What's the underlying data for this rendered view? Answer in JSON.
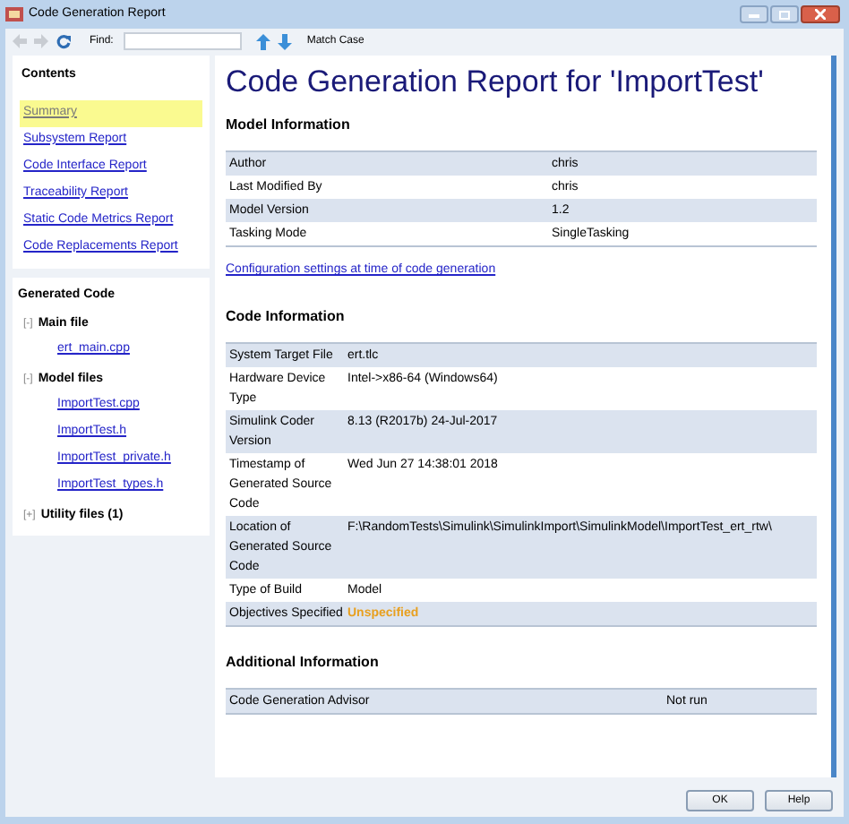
{
  "window": {
    "title": "Code Generation Report"
  },
  "toolbar": {
    "find_label": "Find:",
    "match_case": "Match Case"
  },
  "sidebar": {
    "contents": {
      "heading": "Contents",
      "items": [
        {
          "label": "Summary",
          "selected": true
        },
        {
          "label": "Subsystem Report",
          "selected": false
        },
        {
          "label": "Code Interface Report",
          "selected": false
        },
        {
          "label": "Traceability Report",
          "selected": false
        },
        {
          "label": "Static Code Metrics Report",
          "selected": false
        },
        {
          "label": "Code Replacements Report",
          "selected": false
        }
      ]
    },
    "generated_code": {
      "heading": "Generated Code",
      "groups": [
        {
          "toggle": "[-]",
          "label": "Main file",
          "files": [
            "ert_main.cpp"
          ]
        },
        {
          "toggle": "[-]",
          "label": "Model files",
          "files": [
            "ImportTest.cpp",
            "ImportTest.h",
            "ImportTest_private.h",
            "ImportTest_types.h"
          ]
        },
        {
          "toggle": "[+]",
          "label": "Utility files (1)"
        }
      ]
    }
  },
  "main": {
    "title": "Code Generation Report for 'ImportTest'",
    "sections": [
      {
        "heading": "Model Information",
        "rows": [
          {
            "label": "Author",
            "value": "chris",
            "kind": "normal"
          },
          {
            "label": "Last Modified By",
            "value": "chris",
            "kind": "normal"
          },
          {
            "label": "Model Version",
            "value": "1.2",
            "kind": "normal"
          },
          {
            "label": "Tasking Mode",
            "value": "SingleTasking",
            "kind": "normal"
          }
        ],
        "link": "Configuration settings at time of code generation"
      },
      {
        "heading": "Code Information",
        "rows": [
          {
            "label": "System Target File",
            "value": "ert.tlc",
            "kind": "normal"
          },
          {
            "label": "Hardware Device Type",
            "value": "Intel->x86-64 (Windows64)",
            "kind": "normal"
          },
          {
            "label": "Simulink Coder Version",
            "value": "8.13 (R2017b) 24-Jul-2017",
            "kind": "normal"
          },
          {
            "label": "Timestamp of Generated Source Code",
            "value": "Wed Jun 27 14:38:01 2018",
            "kind": "normal"
          },
          {
            "label": "Location of Generated Source Code",
            "value": "F:\\RandomTests\\Simulink\\SimulinkImport\\SimulinkModel\\ImportTest_ert_rtw\\",
            "kind": "normal"
          },
          {
            "label": "Type of Build",
            "value": "Model",
            "kind": "normal"
          },
          {
            "label": "Objectives Specified",
            "value": "Unspecified",
            "kind": "warning"
          }
        ]
      },
      {
        "heading": "Additional Information",
        "rows": [
          {
            "label": "Code Generation Advisor",
            "value": "Not run",
            "kind": "normal"
          }
        ]
      }
    ]
  },
  "buttons": [
    "OK",
    "Help"
  ]
}
